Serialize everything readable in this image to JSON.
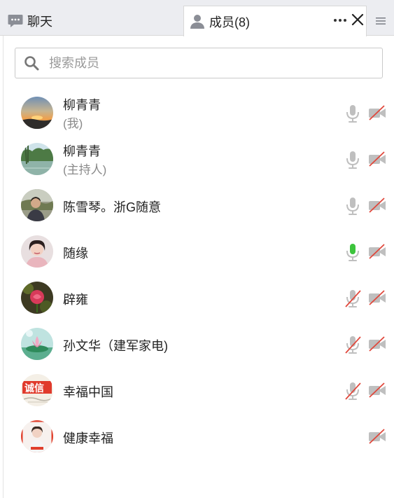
{
  "tabs": {
    "chat_label": "聊天",
    "members_label": "成员(8)"
  },
  "search": {
    "placeholder": "搜索成员"
  },
  "colors": {
    "mic_active": "#3cc43c",
    "muted_slash": "#e0483c",
    "icon_gray": "#bfbfbf"
  },
  "members": [
    {
      "name": "柳青青",
      "role": "(我)",
      "mic": "idle",
      "camera": "off",
      "avatar": "sunset"
    },
    {
      "name": "柳青青",
      "role": "(主持人)",
      "mic": "idle",
      "camera": "off",
      "avatar": "lake"
    },
    {
      "name": "陈雪琴。浙G随意",
      "role": "",
      "mic": "idle",
      "camera": "off",
      "avatar": "portrait-outdoor"
    },
    {
      "name": "随缘",
      "role": "",
      "mic": "speaking",
      "camera": "off",
      "avatar": "portrait-woman"
    },
    {
      "name": "辟雍",
      "role": "",
      "mic": "muted",
      "camera": "off",
      "avatar": "rose"
    },
    {
      "name": "孙文华（建军家电)",
      "role": "",
      "mic": "muted",
      "camera": "off",
      "avatar": "lotus"
    },
    {
      "name": "幸福中国",
      "role": "",
      "mic": "muted",
      "camera": "off",
      "avatar": "cheng-xin-sign"
    },
    {
      "name": "健康幸福",
      "role": "",
      "mic": "none",
      "camera": "off",
      "avatar": "portrait-red"
    }
  ]
}
